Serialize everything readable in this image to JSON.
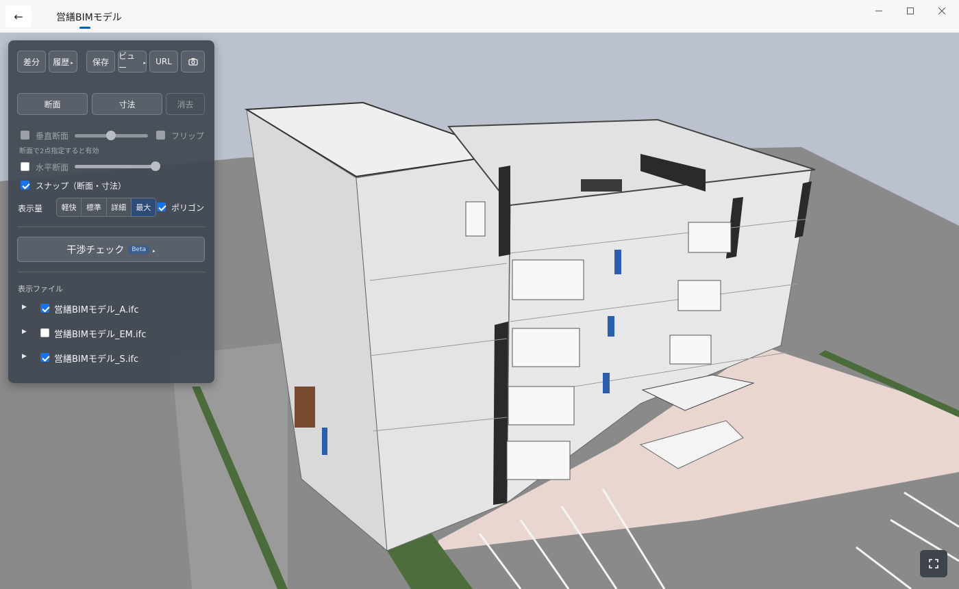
{
  "window": {
    "title": "営繕BIMモデル",
    "back_label": "←"
  },
  "toolbar": {
    "diff": "差分",
    "history": "履歴",
    "save": "保存",
    "view": "ビュー",
    "url": "URL",
    "camera_icon": "camera-icon"
  },
  "modes": {
    "section": "断面",
    "dimension": "寸法",
    "clear": "消去"
  },
  "section_opts": {
    "vertical_label": "垂直断面",
    "vertical_checked": false,
    "vertical_enabled": false,
    "flip_label": "フリップ",
    "hint": "断面で2点指定すると有効",
    "horizontal_label": "水平断面",
    "horizontal_checked": false,
    "snap_label": "スナップ（断面・寸法）",
    "snap_checked": true
  },
  "display": {
    "label": "表示量",
    "levels": [
      "軽快",
      "標準",
      "詳細",
      "最大"
    ],
    "active_level": "最大",
    "polygon_label": "ポリゴン",
    "polygon_checked": true
  },
  "interference": {
    "label": "干渉チェック",
    "badge": "Beta"
  },
  "files": {
    "header": "表示ファイル",
    "items": [
      {
        "name": "営繕BIMモデル_A.ifc",
        "checked": true
      },
      {
        "name": "営繕BIMモデル_EM.ifc",
        "checked": false
      },
      {
        "name": "営繕BIMモデル_S.ifc",
        "checked": true
      }
    ]
  },
  "colors": {
    "accent": "#005fb8",
    "panel_bg": "#424852",
    "active_segment": "#2f4b78",
    "checkbox": "#1a73e8"
  }
}
